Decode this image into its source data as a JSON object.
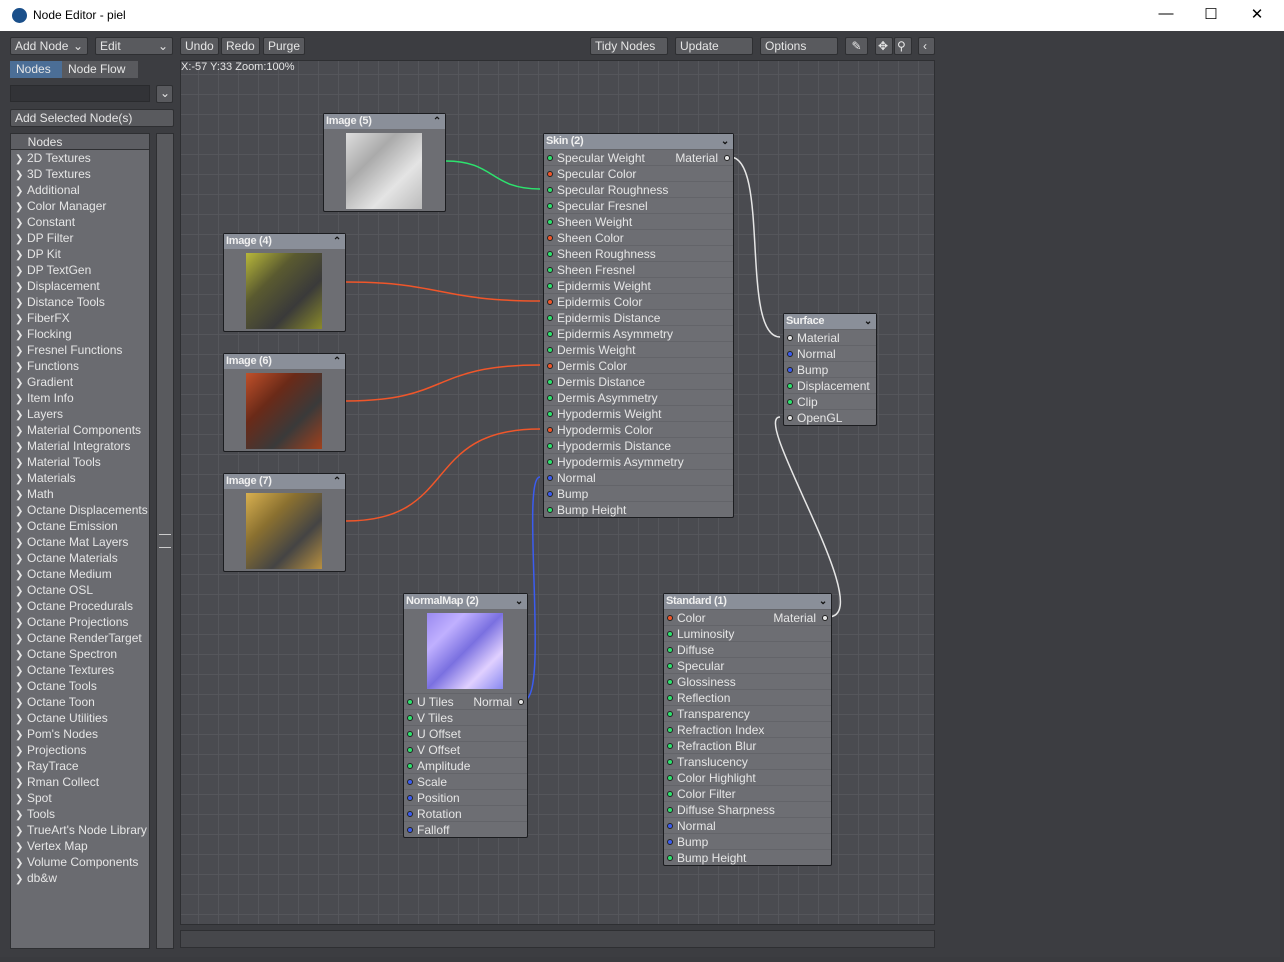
{
  "window": {
    "title": "Node Editor - piel",
    "min": "—",
    "max": "☐",
    "close": "✕"
  },
  "toolbar": {
    "add_node": "Add Node",
    "edit": "Edit",
    "undo": "Undo",
    "redo": "Redo",
    "purge": "Purge",
    "tidy": "Tidy Nodes",
    "update": "Update",
    "options": "Options"
  },
  "tabs": {
    "nodes": "Nodes",
    "node_flow": "Node Flow"
  },
  "sidebar": {
    "add_selected": "Add Selected Node(s)",
    "list_header": "Nodes",
    "items": [
      "2D Textures",
      "3D Textures",
      "Additional",
      "Color Manager",
      "Constant",
      "DP Filter",
      "DP Kit",
      "DP TextGen",
      "Displacement",
      "Distance Tools",
      "FiberFX",
      "Flocking",
      "Fresnel Functions",
      "Functions",
      "Gradient",
      "Item Info",
      "Layers",
      "Material Components",
      "Material Integrators",
      "Material Tools",
      "Materials",
      "Math",
      "Octane Displacements",
      "Octane Emission",
      "Octane Mat Layers",
      "Octane Materials",
      "Octane Medium",
      "Octane OSL",
      "Octane Procedurals",
      "Octane Projections",
      "Octane RenderTarget",
      "Octane Spectron",
      "Octane Textures",
      "Octane Tools",
      "Octane Toon",
      "Octane Utilities",
      "Pom's Nodes",
      "Projections",
      "RayTrace",
      "Rman Collect",
      "Spot",
      "Tools",
      "TrueArt's Node Library",
      "Vertex Map",
      "Volume Components",
      "db&w"
    ]
  },
  "canvas": {
    "status": "X:-57 Y:33 Zoom:100%"
  },
  "nodes": {
    "image5a": {
      "title": "Image (5)"
    },
    "image4": {
      "title": "Image (4)"
    },
    "image6": {
      "title": "Image (6)"
    },
    "image7": {
      "title": "Image (7)"
    },
    "skin": {
      "title": "Skin (2)",
      "output": "Material",
      "inputs": [
        [
          "Specular Weight",
          "g"
        ],
        [
          "Specular Color",
          "r"
        ],
        [
          "Specular Roughness",
          "g"
        ],
        [
          "Specular Fresnel",
          "g"
        ],
        [
          "Sheen Weight",
          "g"
        ],
        [
          "Sheen Color",
          "r"
        ],
        [
          "Sheen Roughness",
          "g"
        ],
        [
          "Sheen Fresnel",
          "g"
        ],
        [
          "Epidermis Weight",
          "g"
        ],
        [
          "Epidermis Color",
          "r"
        ],
        [
          "Epidermis Distance",
          "g"
        ],
        [
          "Epidermis Asymmetry",
          "g"
        ],
        [
          "Dermis Weight",
          "g"
        ],
        [
          "Dermis Color",
          "r"
        ],
        [
          "Dermis Distance",
          "g"
        ],
        [
          "Dermis Asymmetry",
          "g"
        ],
        [
          "Hypodermis Weight",
          "g"
        ],
        [
          "Hypodermis Color",
          "r"
        ],
        [
          "Hypodermis Distance",
          "g"
        ],
        [
          "Hypodermis Asymmetry",
          "g"
        ],
        [
          "Normal",
          "b"
        ],
        [
          "Bump",
          "b"
        ],
        [
          "Bump Height",
          "g"
        ]
      ]
    },
    "surface": {
      "title": "Surface",
      "inputs": [
        [
          "Material",
          "w"
        ],
        [
          "Normal",
          "b"
        ],
        [
          "Bump",
          "b"
        ],
        [
          "Displacement",
          "g"
        ],
        [
          "Clip",
          "g"
        ],
        [
          "OpenGL",
          "w"
        ]
      ]
    },
    "normalmap": {
      "title": "NormalMap (2)",
      "output": "Normal",
      "inputs": [
        [
          "U Tiles",
          "g"
        ],
        [
          "V Tiles",
          "g"
        ],
        [
          "U Offset",
          "g"
        ],
        [
          "V Offset",
          "g"
        ],
        [
          "Amplitude",
          "g"
        ],
        [
          "Scale",
          "b"
        ],
        [
          "Position",
          "b"
        ],
        [
          "Rotation",
          "b"
        ],
        [
          "Falloff",
          "b"
        ]
      ]
    },
    "standard": {
      "title": "Standard (1)",
      "output": "Material",
      "inputs": [
        [
          "Color",
          "r"
        ],
        [
          "Luminosity",
          "g"
        ],
        [
          "Diffuse",
          "g"
        ],
        [
          "Specular",
          "g"
        ],
        [
          "Glossiness",
          "g"
        ],
        [
          "Reflection",
          "g"
        ],
        [
          "Transparency",
          "g"
        ],
        [
          "Refraction Index",
          "g"
        ],
        [
          "Refraction Blur",
          "g"
        ],
        [
          "Translucency",
          "g"
        ],
        [
          "Color Highlight",
          "g"
        ],
        [
          "Color Filter",
          "g"
        ],
        [
          "Diffuse Sharpness",
          "g"
        ],
        [
          "Normal",
          "b"
        ],
        [
          "Bump",
          "b"
        ],
        [
          "Bump Height",
          "g"
        ]
      ]
    }
  },
  "colors": {
    "green_wire": "#2de36e",
    "red_wire": "#f0562a",
    "blue_wire": "#3b5cf0",
    "white_wire": "#e6e6e6"
  }
}
